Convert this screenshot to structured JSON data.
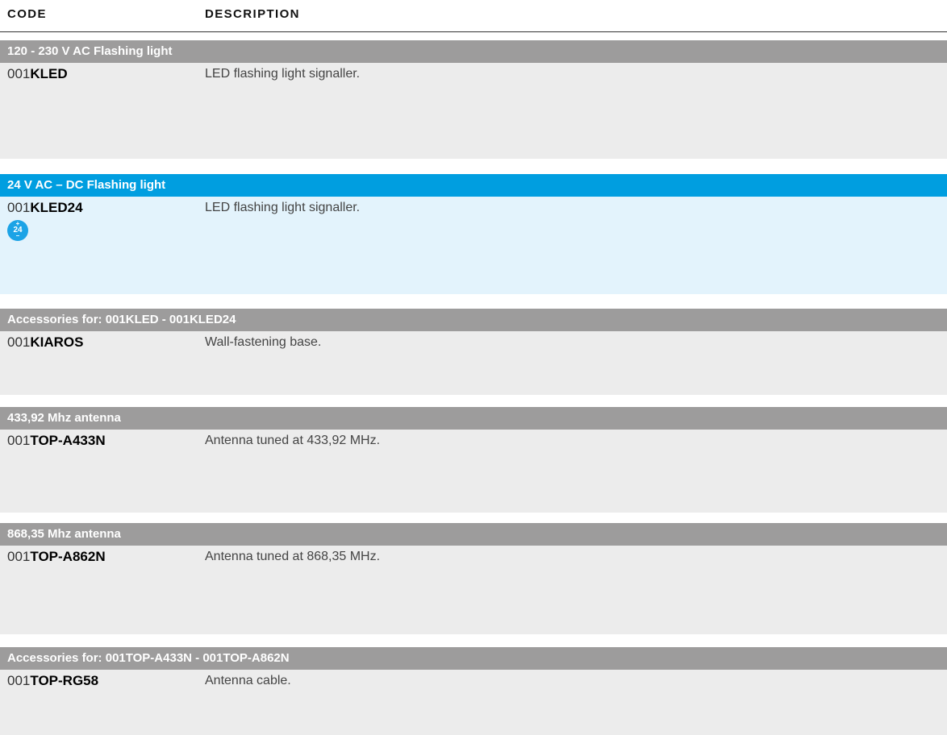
{
  "columns": {
    "code": "CODE",
    "description": "DESCRIPTION"
  },
  "sections": [
    {
      "title": "120 - 230 V AC Flashing light",
      "style": "gray",
      "item": {
        "prefix": "001",
        "code": "KLED",
        "description": "LED flashing light signaller."
      }
    },
    {
      "title": "24 V AC – DC Flashing light",
      "style": "blue",
      "item": {
        "prefix": "001",
        "code": "KLED24",
        "description": "LED flashing light signaller.",
        "badge": {
          "plus": "+",
          "value": "24",
          "minus": "–"
        }
      }
    },
    {
      "title": "Accessories for: 001KLED - 001KLED24",
      "style": "gray",
      "item": {
        "prefix": "001",
        "code": "KIAROS",
        "description": "Wall-fastening base."
      }
    },
    {
      "title": "433,92 Mhz antenna",
      "style": "gray",
      "item": {
        "prefix": "001",
        "code": "TOP-A433N",
        "description": "Antenna tuned at 433,92 MHz."
      }
    },
    {
      "title": "868,35 Mhz antenna",
      "style": "gray",
      "item": {
        "prefix": "001",
        "code": "TOP-A862N",
        "description": "Antenna tuned at 868,35 MHz."
      }
    },
    {
      "title": "Accessories for: 001TOP-A433N - 001TOP-A862N",
      "style": "gray",
      "item": {
        "prefix": "001",
        "code": "TOP-RG58",
        "description": "Antenna cable."
      }
    }
  ],
  "colors": {
    "gray_header": "#9d9c9c",
    "gray_body": "#ececec",
    "blue_header": "#009ee0",
    "blue_body": "#e3f3fc"
  }
}
